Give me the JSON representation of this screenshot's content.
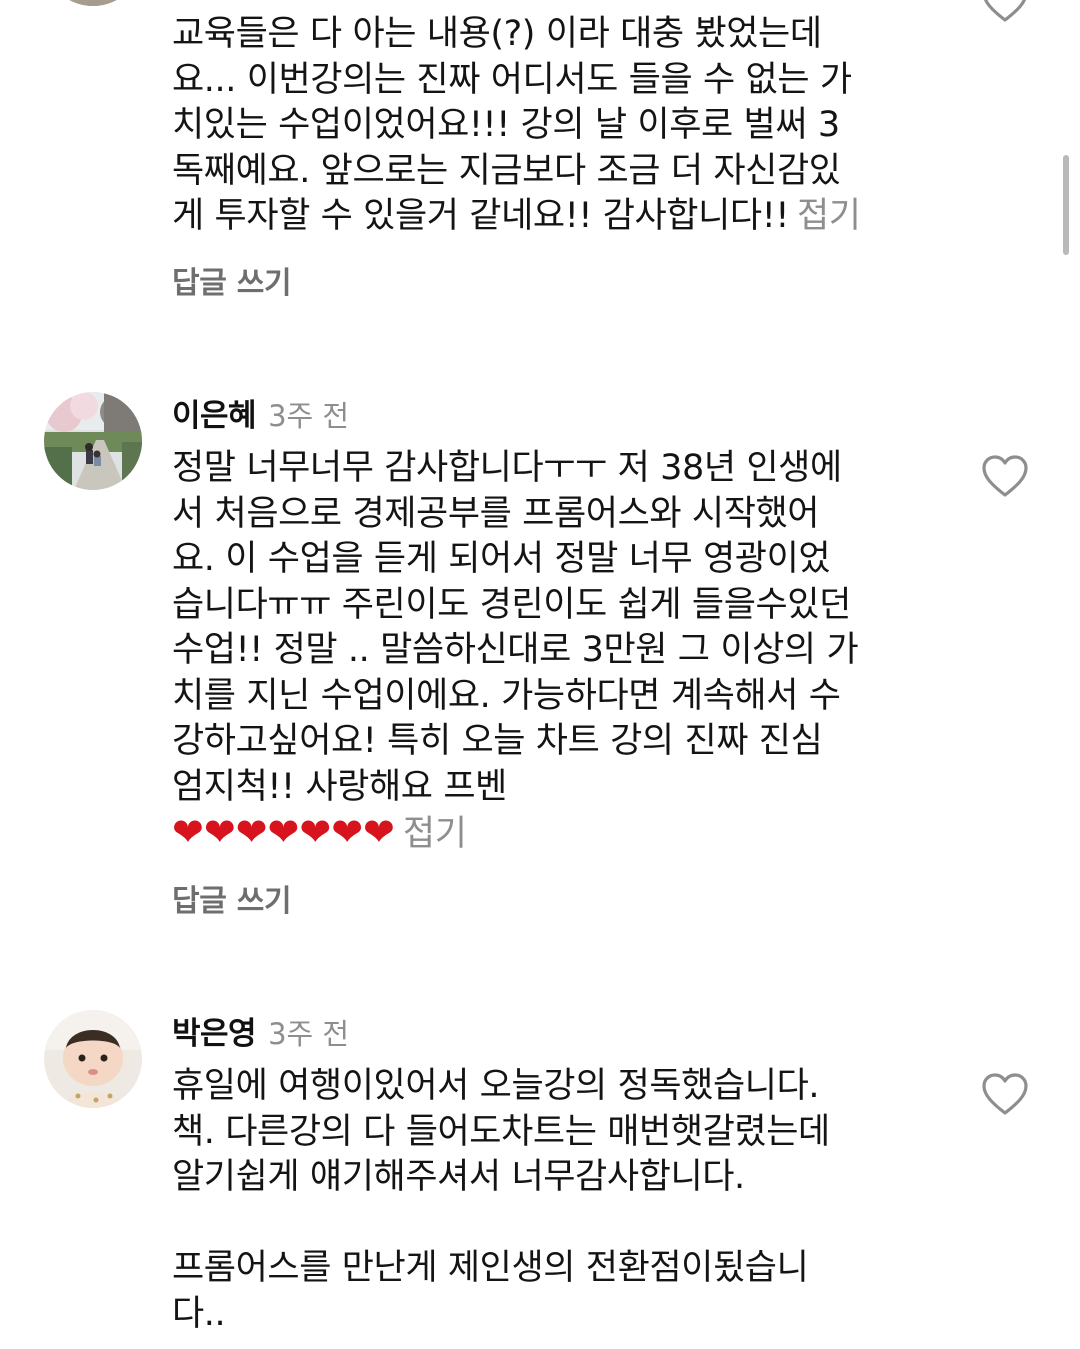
{
  "comment_top": {
    "partial_top_line": "",
    "lines": [
      "교육들은 다 아는 내용(?) 이라 대충 봤었는데",
      "요... 이번강의는 진짜 어디서도 들을 수 없는 가",
      "치있는 수업이었어요!!! 강의 날 이후로 벌써 3",
      "독째예요. 앞으로는 지금보다 조금 더 자신감있",
      "게 투자할 수 있을거 같네요!! 감사합니다!!"
    ],
    "fold_label": "접기",
    "reply_label": "답글 쓰기"
  },
  "comment_2": {
    "username": "이은혜",
    "time": "3주 전",
    "lines": [
      "정말 너무너무 감사합니다ㅜㅜ 저 38년 인생에",
      "서 처음으로 경제공부를 프롬어스와 시작했어",
      "요. 이 수업을 듣게 되어서 정말 너무 영광이었",
      "습니다ㅠㅠ 주린이도 경린이도 쉽게 들을수있던",
      "수업!! 정말 .. 말씀하신대로 3만원 그 이상의 가",
      "치를 지닌 수업이에요. 가능하다면 계속해서 수",
      "강하고싶어요! 특히 오늘 차트 강의 진짜 진심",
      "엄지척!! 사랑해요 프벤"
    ],
    "hearts": "❤❤❤❤❤❤❤",
    "fold_label": "접기",
    "reply_label": "답글 쓰기"
  },
  "comment_3": {
    "username": "박은영",
    "time": "3주 전",
    "lines": [
      "휴일에  여행이있어서  오늘강의 정독했습니다.",
      "책. 다른강의 다 들어도차트는  매번햇갈렸는데",
      "알기쉽게  얘기해주셔서 너무감사합니다."
    ],
    "lines_after_blank": [
      "프롬어스를 만난게 제인생의 전환점이됬습니",
      "다.."
    ]
  },
  "icons": {
    "like": "heart-outline-icon",
    "like_color": "#8e8e8e"
  },
  "colors": {
    "text": "#141414",
    "muted": "#8e8e8e",
    "reply": "#6e6e6e",
    "heart": "#d7141e"
  }
}
